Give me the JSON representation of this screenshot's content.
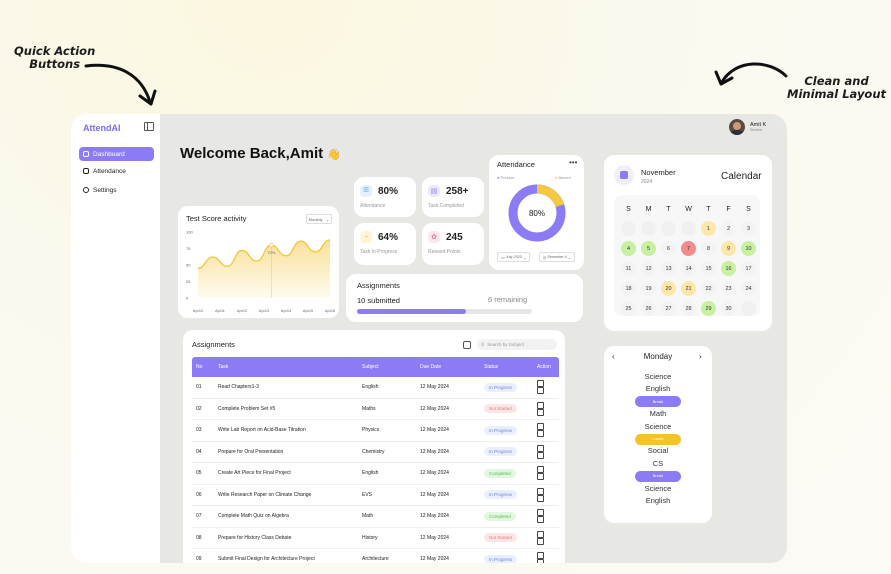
{
  "annotations": {
    "left": [
      "Quick Action",
      "Buttons"
    ],
    "right": [
      "Clean and",
      "Minimal Layout"
    ]
  },
  "app": {
    "brand": "AttendAI",
    "user": {
      "name": "Amit K",
      "role": "Student"
    },
    "greeting": "Welcome Back,Amit",
    "greeting_emoji": "👋"
  },
  "sidebar": {
    "items": [
      {
        "label": "Dashboard",
        "icon": "dashboard-icon",
        "active": true
      },
      {
        "label": "Attendance",
        "icon": "attendance-icon"
      },
      {
        "label": "Settings",
        "icon": "gear-icon"
      }
    ]
  },
  "test_score": {
    "title": "Test Score activity",
    "range": "Monthly",
    "tooltip": "72%"
  },
  "chart_data": {
    "type": "area",
    "title": "Test Score activity",
    "categories": [
      "Apr10",
      "Apr11",
      "Apr12",
      "Apr13",
      "Apr14",
      "Apr15",
      "Apr16"
    ],
    "ylim": [
      0,
      100
    ],
    "yticks": [
      0,
      25,
      50,
      75,
      100
    ],
    "series": [
      {
        "values": [
          45,
          62,
          48,
          72,
          56,
          80,
          64,
          86,
          70,
          88
        ]
      }
    ],
    "color": "#f5c843"
  },
  "stats": [
    {
      "value": "80%",
      "label": "Attendance",
      "icon": "people-icon",
      "tint": "#e6f1fb",
      "color": "#6aa6e8"
    },
    {
      "value": "258+",
      "label": "Task Completed",
      "icon": "task-icon",
      "tint": "#ece9fd",
      "color": "#8b7cf6"
    },
    {
      "value": "64%",
      "label": "Task In Progress",
      "icon": "progress-icon",
      "tint": "#fdf4d9",
      "color": "#e9b62c"
    },
    {
      "value": "245",
      "label": "Reward Points",
      "icon": "reward-icon",
      "tint": "#fde7ef",
      "color": "#e87aa0"
    }
  ],
  "attendance": {
    "title": "Attendance",
    "legend_present": "Present",
    "legend_absent": "Absent",
    "center_value": "80%",
    "present": 80,
    "absent": 20,
    "present_color": "#8b7cf6",
    "absent_color": "#f5c843",
    "filter_month": "July 2023",
    "filter_sem": "Semester 4"
  },
  "assignments_summary": {
    "title": "Assignments",
    "submitted": "10 submitted",
    "remaining": "6 remaining",
    "progress": 0.62
  },
  "assignments_table": {
    "title": "Assignments",
    "search_placeholder": "Search by Subject",
    "columns": [
      "No",
      "Task",
      "Subject",
      "Due Date",
      "Status",
      "Action"
    ],
    "rows": [
      {
        "no": "01",
        "task": "Read Chapters1-3",
        "subject": "English",
        "due": "12 May 2024",
        "status": "In Progress"
      },
      {
        "no": "02",
        "task": "Complete Problem Set #5",
        "subject": "Maths",
        "due": "12 May 2024",
        "status": "Not Started"
      },
      {
        "no": "03",
        "task": "Write Lab Report on Acid-Base Titration",
        "subject": "Physics",
        "due": "12 May 2024",
        "status": "In Progress"
      },
      {
        "no": "04",
        "task": "Prepare for Oral Presentation",
        "subject": "Chemistry",
        "due": "12 May 2024",
        "status": "In Progress"
      },
      {
        "no": "05",
        "task": "Create Art Piece for Final Project",
        "subject": "English",
        "due": "12 May 2024",
        "status": "Completed"
      },
      {
        "no": "06",
        "task": "Write Research Paper on Climate Change",
        "subject": "EVS",
        "due": "12 May 2024",
        "status": "In Progress"
      },
      {
        "no": "07",
        "task": "Complete Math Quiz on Algebra",
        "subject": "Math",
        "due": "12 May 2024",
        "status": "Completed"
      },
      {
        "no": "08",
        "task": "Prepare for History Class Debate",
        "subject": "History",
        "due": "12 May 2024",
        "status": "Not Started"
      },
      {
        "no": "09",
        "task": "Submit Final Design for Architecture Project",
        "subject": "Architecture",
        "due": "12 May 2024",
        "status": "In Progress"
      }
    ]
  },
  "calendar": {
    "month": "November",
    "year": "2024",
    "title": "Calendar",
    "weekdays": [
      "S",
      "M",
      "T",
      "W",
      "T",
      "F",
      "S"
    ],
    "days": [
      {
        "d": ""
      },
      {
        "d": ""
      },
      {
        "d": ""
      },
      {
        "d": ""
      },
      {
        "d": "1",
        "c": "#fde7a8"
      },
      {
        "d": "2"
      },
      {
        "d": "3"
      },
      {
        "d": "4",
        "c": "#c7f0a0"
      },
      {
        "d": "5",
        "c": "#c7f0a0"
      },
      {
        "d": "6"
      },
      {
        "d": "7",
        "c": "#f28b8b"
      },
      {
        "d": "8"
      },
      {
        "d": "9",
        "c": "#fde7a8"
      },
      {
        "d": "10",
        "c": "#c7f0a0"
      },
      {
        "d": "11"
      },
      {
        "d": "12"
      },
      {
        "d": "13"
      },
      {
        "d": "14"
      },
      {
        "d": "15"
      },
      {
        "d": "16",
        "c": "#c7f0a0"
      },
      {
        "d": "17"
      },
      {
        "d": "18"
      },
      {
        "d": "19"
      },
      {
        "d": "20",
        "c": "#fde7a8"
      },
      {
        "d": "21",
        "c": "#fde7a8"
      },
      {
        "d": "22"
      },
      {
        "d": "23"
      },
      {
        "d": "24"
      },
      {
        "d": "25"
      },
      {
        "d": "26"
      },
      {
        "d": "27"
      },
      {
        "d": "28"
      },
      {
        "d": "29",
        "c": "#c7f0a0"
      },
      {
        "d": "30"
      },
      {
        "d": ""
      }
    ]
  },
  "schedule": {
    "day": "Monday",
    "items": [
      {
        "label": "Science"
      },
      {
        "label": "English"
      },
      {
        "label": "Break",
        "pill": "#8b7cf6"
      },
      {
        "label": "Math"
      },
      {
        "label": "Science"
      },
      {
        "label": "Lunch",
        "pill": "#f5c22b"
      },
      {
        "label": "Social"
      },
      {
        "label": "CS"
      },
      {
        "label": "Break",
        "pill": "#8b7cf6"
      },
      {
        "label": "Science"
      },
      {
        "label": "English"
      }
    ]
  }
}
